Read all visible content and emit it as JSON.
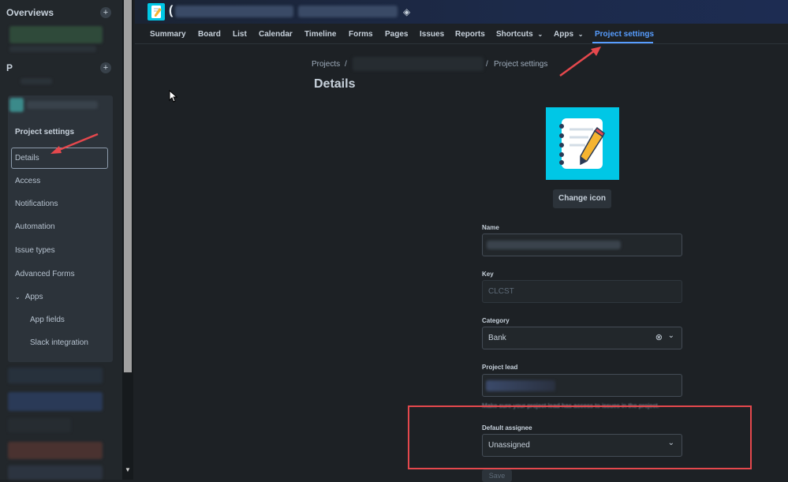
{
  "sidebar": {
    "overviews_label": "Overviews",
    "projects_label": "P",
    "section_title": "Project settings",
    "items": [
      {
        "label": "Details"
      },
      {
        "label": "Access"
      },
      {
        "label": "Notifications"
      },
      {
        "label": "Automation"
      },
      {
        "label": "Issue types"
      },
      {
        "label": "Advanced Forms"
      },
      {
        "label": "Apps"
      },
      {
        "label": "App fields"
      },
      {
        "label": "Slack integration"
      }
    ]
  },
  "header": {
    "project_initial": "("
  },
  "nav": {
    "tabs": [
      {
        "label": "Summary"
      },
      {
        "label": "Board"
      },
      {
        "label": "List"
      },
      {
        "label": "Calendar"
      },
      {
        "label": "Timeline"
      },
      {
        "label": "Forms"
      },
      {
        "label": "Pages"
      },
      {
        "label": "Issues"
      },
      {
        "label": "Reports"
      },
      {
        "label": "Shortcuts"
      },
      {
        "label": "Apps"
      },
      {
        "label": "Project settings"
      }
    ]
  },
  "breadcrumb": {
    "root": "Projects",
    "sep": "/",
    "current": "Project settings"
  },
  "page": {
    "title": "Details",
    "change_icon_label": "Change icon"
  },
  "form": {
    "name_label": "Name",
    "key_label": "Key",
    "key_value": "CLCST",
    "category_label": "Category",
    "category_value": "Bank",
    "lead_label": "Project lead",
    "lead_helper": "Make sure your project lead has access to issues in the project.",
    "assignee_label": "Default assignee",
    "assignee_value": "Unassigned",
    "save_label": "Save"
  },
  "colors": {
    "accent": "#579dff",
    "annotation": "#e5484d",
    "icon_bg": "#00c7e6"
  }
}
